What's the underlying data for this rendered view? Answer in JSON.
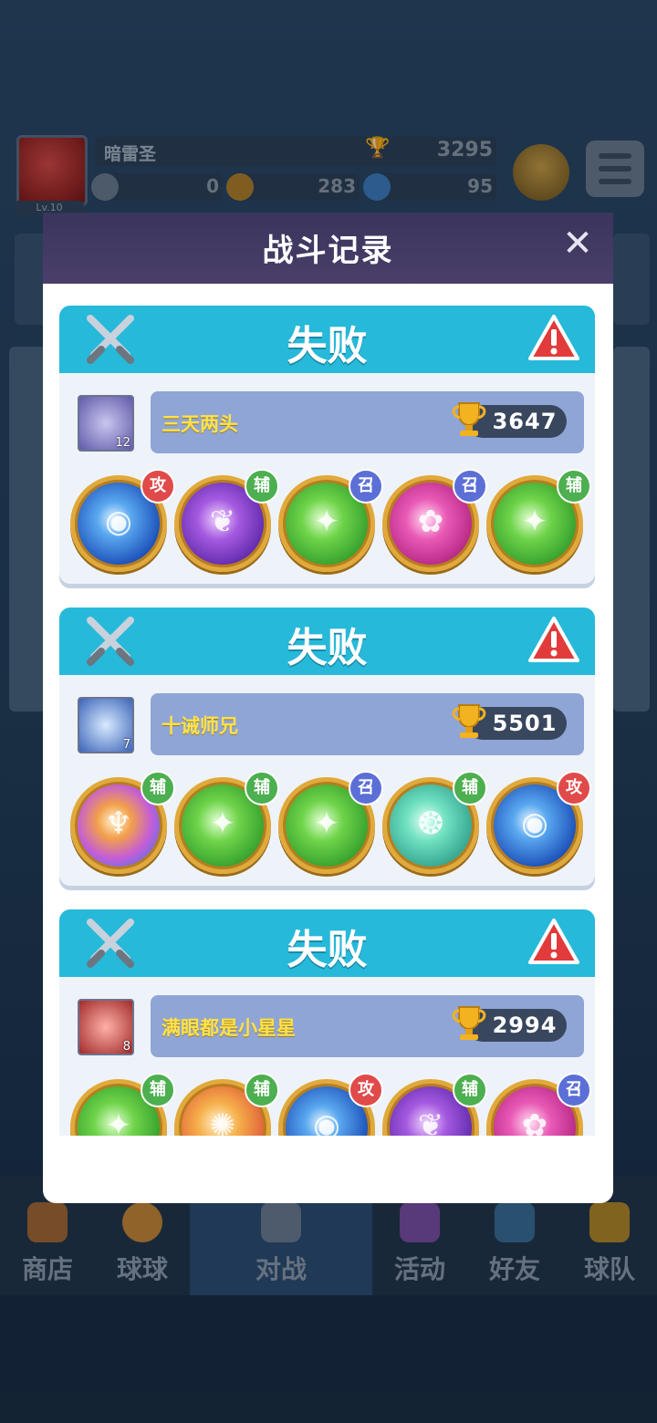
{
  "header": {
    "avatar_level": "Lv.10",
    "player_name": "暗雷圣",
    "trophies": "3295",
    "resources": [
      {
        "name": "coin",
        "value": "0"
      },
      {
        "name": "basketball",
        "value": "283"
      },
      {
        "name": "gem",
        "value": "95"
      }
    ]
  },
  "nav": [
    {
      "label": "商店",
      "icon": "shop-icon"
    },
    {
      "label": "球球",
      "icon": "ball-icon"
    },
    {
      "label": "对战",
      "icon": "battle-icon",
      "active": true
    },
    {
      "label": "活动",
      "icon": "party-icon"
    },
    {
      "label": "好友",
      "icon": "book-icon"
    },
    {
      "label": "球队",
      "icon": "whistle-icon"
    }
  ],
  "modal": {
    "title": "战斗记录",
    "close_icon": "close-icon",
    "records": [
      {
        "result": "失败",
        "player": {
          "name": "三天两头",
          "level": "12",
          "trophies": "3647"
        },
        "balls": [
          {
            "role": "攻",
            "color": "blue"
          },
          {
            "role": "辅",
            "color": "purple"
          },
          {
            "role": "召",
            "color": "green"
          },
          {
            "role": "召",
            "color": "pink"
          },
          {
            "role": "辅",
            "color": "green"
          }
        ]
      },
      {
        "result": "失败",
        "player": {
          "name": "十诫师兄",
          "level": "7",
          "trophies": "5501"
        },
        "balls": [
          {
            "role": "辅",
            "color": "rainbow"
          },
          {
            "role": "辅",
            "color": "green"
          },
          {
            "role": "召",
            "color": "green"
          },
          {
            "role": "辅",
            "color": "teal"
          },
          {
            "role": "攻",
            "color": "blue"
          }
        ]
      },
      {
        "result": "失败",
        "player": {
          "name": "满眼都是小星星",
          "level": "8",
          "trophies": "2994"
        },
        "balls": [
          {
            "role": "辅",
            "color": "green"
          },
          {
            "role": "辅",
            "color": "orange"
          },
          {
            "role": "攻",
            "color": "blue"
          },
          {
            "role": "辅",
            "color": "purple"
          },
          {
            "role": "召",
            "color": "pink"
          }
        ]
      }
    ]
  },
  "colors": {
    "header_bg": "#3a355c",
    "card_header": "#27b9d9",
    "name_yellow": "#ffe24a",
    "role_attack": "#e04a4a",
    "role_support": "#4caf50",
    "role_summon": "#5b6fd6"
  }
}
